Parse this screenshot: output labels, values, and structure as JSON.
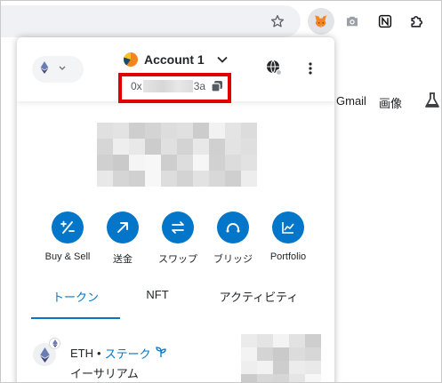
{
  "browser": {
    "toolbar_icons": [
      "star-icon",
      "metamask-fox-icon",
      "camera-icon",
      "notion-icon",
      "puzzle-icon"
    ]
  },
  "page_behind": {
    "bookmarks": [
      "Gmail",
      "画像"
    ]
  },
  "metamask": {
    "network_icon": "ethereum-icon",
    "account_name": "Account 1",
    "address_prefix": "0x",
    "address_suffix": "3a",
    "highlight_color": "#e00000",
    "accent_color": "#0376c9",
    "actions": [
      {
        "label": "Buy & Sell",
        "icon": "buy-sell-icon"
      },
      {
        "label": "送金",
        "icon": "send-arrow-icon"
      },
      {
        "label": "スワップ",
        "icon": "swap-icon"
      },
      {
        "label": "ブリッジ",
        "icon": "bridge-icon"
      },
      {
        "label": "Portfolio",
        "icon": "portfolio-chart-icon"
      }
    ],
    "tabs": [
      {
        "label": "トークン",
        "active": true
      },
      {
        "label": "NFT",
        "active": false
      },
      {
        "label": "アクティビティ",
        "active": false
      }
    ],
    "token": {
      "symbol": "ETH",
      "separator": "•",
      "stake_label": "ステーク",
      "name": "イーサリアム"
    }
  }
}
